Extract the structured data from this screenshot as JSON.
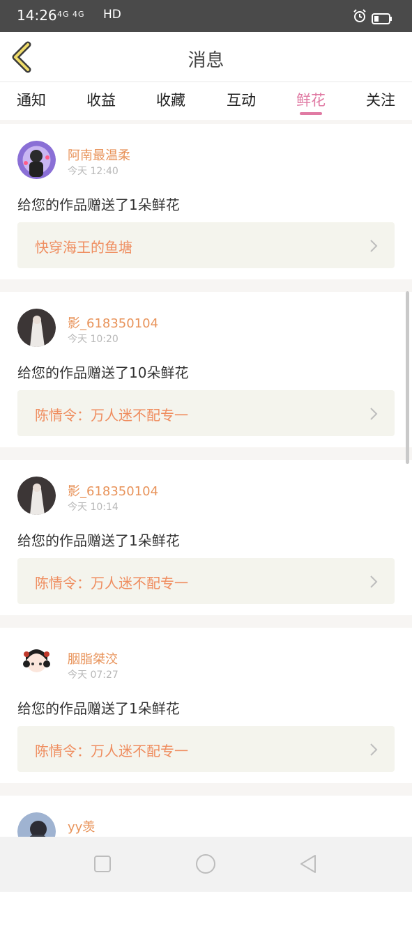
{
  "status_bar": {
    "time": "14:26",
    "network_label": "4G  4G",
    "hd_label": "HD"
  },
  "header": {
    "title": "消息"
  },
  "tabs": [
    {
      "label": "通知"
    },
    {
      "label": "收益"
    },
    {
      "label": "收藏"
    },
    {
      "label": "互动"
    },
    {
      "label": "鲜花",
      "active": true
    },
    {
      "label": "关注"
    }
  ],
  "messages": [
    {
      "user": "阿南最温柔",
      "time": "今天 12:40",
      "text": "给您的作品赠送了1朵鲜花",
      "work": "快穿海王的鱼塘"
    },
    {
      "user": "影_618350104",
      "time": "今天 10:20",
      "text": "给您的作品赠送了10朵鲜花",
      "work": "陈情令：万人迷不配专一"
    },
    {
      "user": "影_618350104",
      "time": "今天 10:14",
      "text": "给您的作品赠送了1朵鲜花",
      "work": "陈情令：万人迷不配专一"
    },
    {
      "user": "胭脂桀洨",
      "time": "今天 07:27",
      "text": "给您的作品赠送了1朵鲜花",
      "work": "陈情令：万人迷不配专一"
    },
    {
      "user": "yy羡"
    }
  ],
  "colors": {
    "accent": "#e07aa3",
    "username": "#e8935a",
    "work_title": "#ef8d5f",
    "work_bg": "#f4f4ed"
  },
  "icons": {
    "back": "chevron-left-icon",
    "item_arrow": "chevron-right-icon",
    "alarm": "alarm-icon",
    "battery": "battery-icon",
    "nav": [
      "recent-apps-icon",
      "home-icon",
      "back-triangle-icon"
    ]
  }
}
